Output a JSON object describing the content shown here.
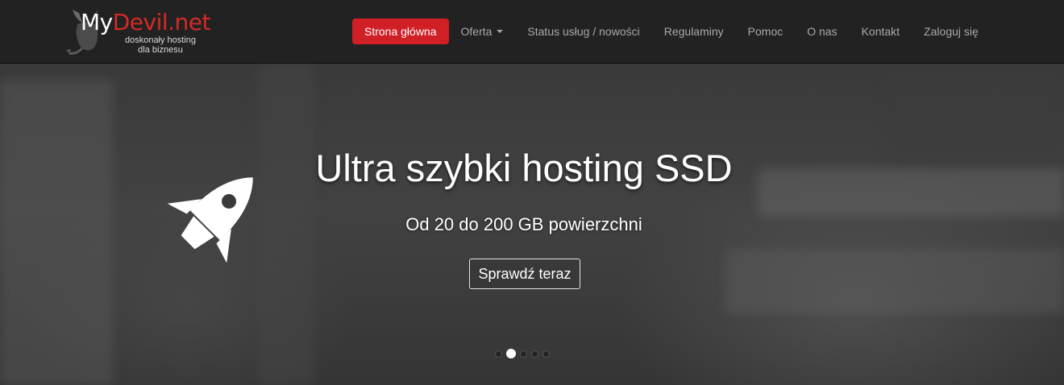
{
  "logo": {
    "brand_my": "My",
    "brand_devil": "Devil.net",
    "tagline_line1": "doskonały hosting",
    "tagline_line2": "dla biznesu",
    "icon": "devil-logo-icon"
  },
  "nav": {
    "items": [
      {
        "label": "Strona główna",
        "active": true
      },
      {
        "label": "Oferta",
        "dropdown": true
      },
      {
        "label": "Status usług / nowości"
      },
      {
        "label": "Regulaminy"
      },
      {
        "label": "Pomoc"
      },
      {
        "label": "O nas"
      },
      {
        "label": "Kontakt"
      },
      {
        "label": "Zaloguj się"
      }
    ]
  },
  "hero": {
    "title": "Ultra szybki hosting SSD",
    "subtitle": "Od 20 do 200 GB powierzchni",
    "button_label": "Sprawdź teraz",
    "icon": "rocket-icon",
    "slides_count": 5,
    "active_slide": 2
  },
  "colors": {
    "navbar_bg": "#222222",
    "accent_red": "#d11f26",
    "nav_text": "#a8a8a8"
  }
}
